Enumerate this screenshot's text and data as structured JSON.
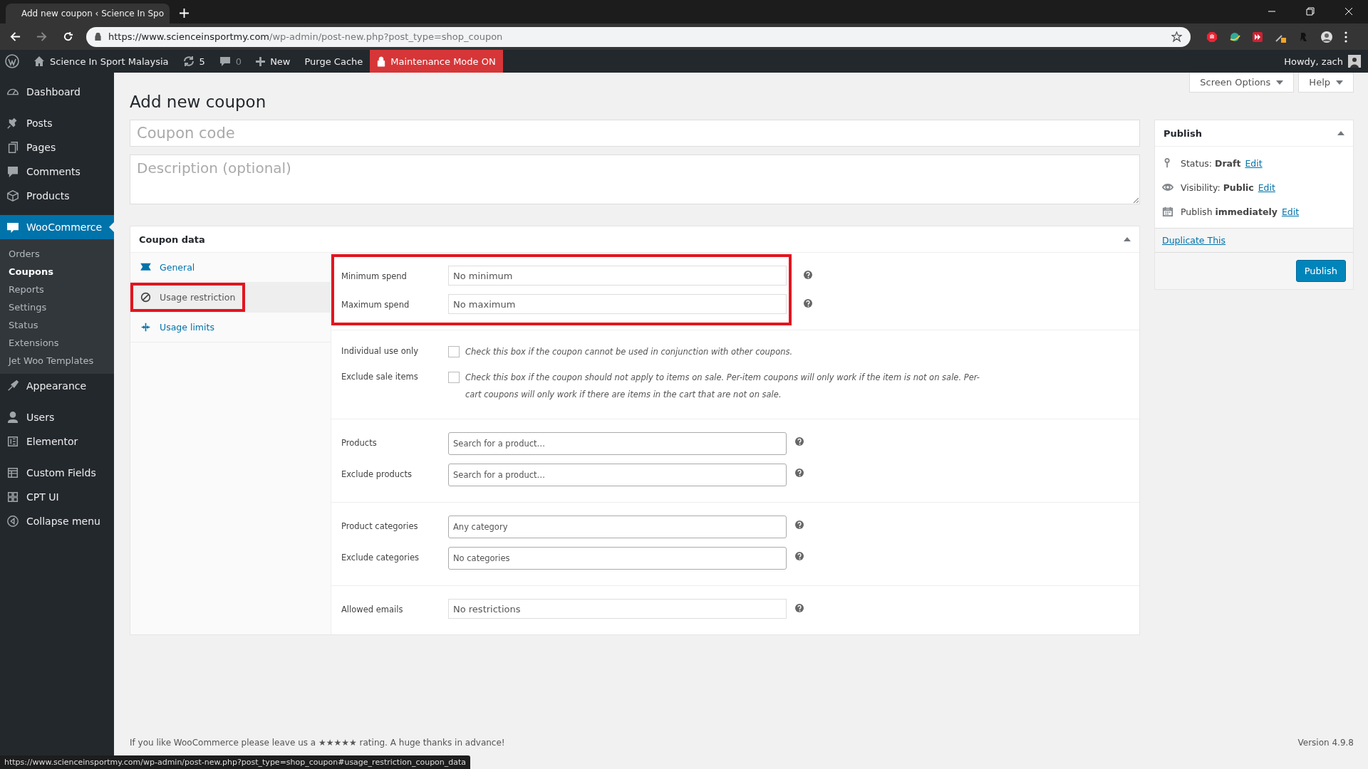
{
  "browser": {
    "tab_title": "Add new coupon ‹ Science In Spo",
    "url_host": "https://www.scienceinsportmy.com",
    "url_path": "/wp-admin/post-new.php?post_type=shop_coupon"
  },
  "admin_bar": {
    "site_name": "Science In Sport Malaysia",
    "updates": "5",
    "comments": "0",
    "new": "New",
    "purge": "Purge Cache",
    "maintenance": "Maintenance Mode ON",
    "howdy": "Howdy, zach"
  },
  "sidebar": {
    "items": [
      {
        "label": "Dashboard",
        "selected": false
      },
      {
        "label": "Posts",
        "selected": false
      },
      {
        "label": "Pages",
        "selected": false
      },
      {
        "label": "Comments",
        "selected": false
      },
      {
        "label": "Products",
        "selected": false
      },
      {
        "label": "WooCommerce",
        "selected": true,
        "children": [
          {
            "label": "Orders",
            "selected": false
          },
          {
            "label": "Coupons",
            "selected": true
          },
          {
            "label": "Reports",
            "selected": false
          },
          {
            "label": "Settings",
            "selected": false
          },
          {
            "label": "Status",
            "selected": false
          },
          {
            "label": "Extensions",
            "selected": false
          },
          {
            "label": "Jet Woo Templates",
            "selected": false
          }
        ]
      },
      {
        "label": "Appearance",
        "selected": false
      },
      {
        "label": "Users",
        "selected": false
      },
      {
        "label": "Elementor",
        "selected": false
      },
      {
        "label": "Custom Fields",
        "selected": false
      },
      {
        "label": "CPT UI",
        "selected": false
      },
      {
        "label": "Collapse menu",
        "selected": false
      }
    ]
  },
  "screen_buttons": [
    "Screen Options",
    "Help"
  ],
  "page_title": "Add new coupon",
  "coupon_code": {
    "placeholder": "Coupon code"
  },
  "description": {
    "placeholder": "Description (optional)"
  },
  "coupon_data": {
    "title": "Coupon data",
    "tabs": [
      {
        "label": "General",
        "selected": false,
        "highlighted": false
      },
      {
        "label": "Usage restriction",
        "selected": true,
        "highlighted": true
      },
      {
        "label": "Usage limits",
        "selected": false,
        "highlighted": false
      }
    ],
    "groups": [
      {
        "highlighted": true,
        "fields": [
          {
            "kind": "text",
            "label": "Minimum spend",
            "placeholder": "No minimum"
          },
          {
            "kind": "text",
            "label": "Maximum spend",
            "placeholder": "No maximum"
          }
        ]
      },
      {
        "highlighted": false,
        "fields": [
          {
            "kind": "checkbox",
            "label": "Individual use only",
            "checked": false,
            "description": "Check this box if the coupon cannot be used in conjunction with other coupons."
          },
          {
            "kind": "checkbox",
            "label": "Exclude sale items",
            "checked": false,
            "description": "Check this box if the coupon should not apply to items on sale. Per-item coupons will only work if the item is not on sale. Per-cart coupons will only work if there are items in the cart that are not on sale."
          }
        ]
      },
      {
        "highlighted": false,
        "fields": [
          {
            "kind": "select",
            "label": "Products",
            "placeholder": "Search for a product…"
          },
          {
            "kind": "select",
            "label": "Exclude products",
            "placeholder": "Search for a product…"
          }
        ]
      },
      {
        "highlighted": false,
        "fields": [
          {
            "kind": "select",
            "label": "Product categories",
            "placeholder": "Any category"
          },
          {
            "kind": "select",
            "label": "Exclude categories",
            "placeholder": "No categories"
          }
        ]
      },
      {
        "highlighted": false,
        "fields": [
          {
            "kind": "text",
            "label": "Allowed emails",
            "placeholder": "No restrictions"
          }
        ]
      }
    ]
  },
  "publish": {
    "title": "Publish",
    "rows": [
      {
        "label": "Status:",
        "value": "Draft",
        "link": "Edit"
      },
      {
        "label": "Visibility:",
        "value": "Public",
        "link": "Edit"
      },
      {
        "label": "Publish",
        "value": "immediately",
        "link": "Edit"
      }
    ],
    "duplicate": "Duplicate This",
    "button": "Publish"
  },
  "footer": {
    "text": "If you like WooCommerce please leave us a ★★★★★ rating. A huge thanks in advance!",
    "version": "Version 4.9.8"
  },
  "status_url": "https://www.scienceinsportmy.com/wp-admin/post-new.php?post_type=shop_coupon#usage_restriction_coupon_data"
}
